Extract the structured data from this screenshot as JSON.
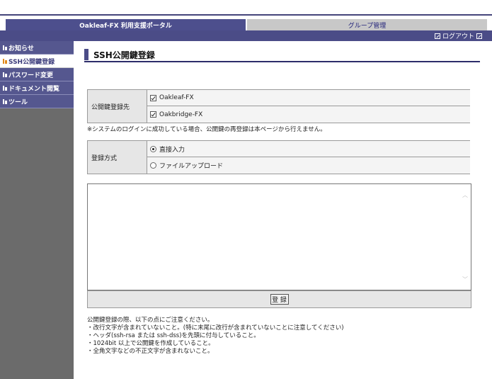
{
  "header": {
    "portal_tab": "Oakleaf-FX 利用支援ポータル",
    "group_tab": "グループ管理",
    "logout_label": "ログアウト"
  },
  "sidebar": {
    "items": [
      {
        "label": "お知らせ",
        "active": false
      },
      {
        "label": "SSH公開鍵登録",
        "active": true
      },
      {
        "label": "パスワード変更",
        "active": false
      },
      {
        "label": "ドキュメント閲覧",
        "active": false
      },
      {
        "label": "ツール",
        "active": false
      }
    ]
  },
  "main": {
    "title": "SSH公開鍵登録",
    "destination": {
      "label": "公開鍵登録先",
      "options": [
        {
          "label": "Oakleaf-FX",
          "checked": true
        },
        {
          "label": "Oakbridge-FX",
          "checked": true
        }
      ]
    },
    "note": "※システムのログインに成功している場合、公開鍵の再登録は本ページから行えません。",
    "method": {
      "label": "登録方式",
      "options": [
        {
          "label": "直接入力",
          "selected": true
        },
        {
          "label": "ファイルアップロード",
          "selected": false
        }
      ]
    },
    "key_input_value": "",
    "submit_label": "登 録",
    "notes": [
      "公開鍵登録の際、以下の点にご注意ください。",
      "・改行文字が含まれていないこと。(特に末尾に改行が含まれていないことに注意してください)",
      "・ヘッダ(ssh-rsa または ssh-dss)を先頭に付与していること。",
      "・1024bit 以上で公開鍵を作成していること。",
      "・全角文字などの不正文字が含まれないこと。"
    ]
  }
}
